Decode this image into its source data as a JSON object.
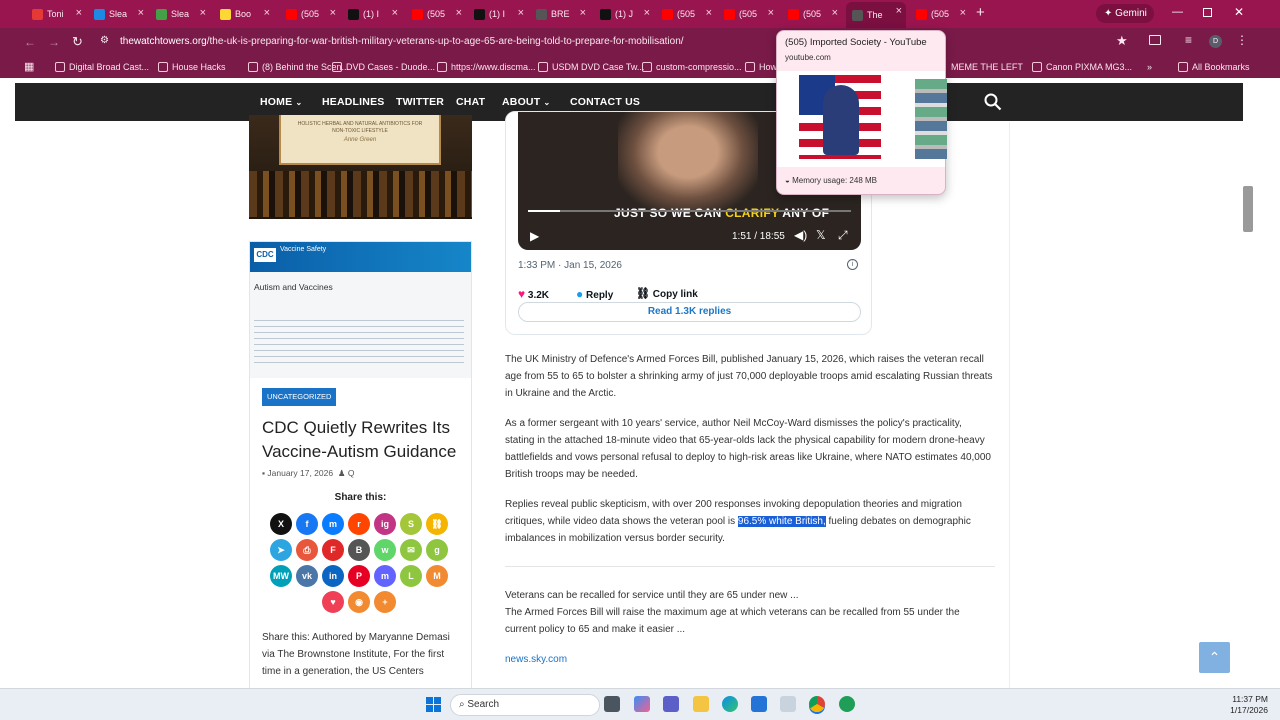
{
  "browser": {
    "tabs": [
      {
        "label": "Toni",
        "color": "#e53935"
      },
      {
        "label": "Slea",
        "color": "#1e88e5"
      },
      {
        "label": "Slea",
        "color": "#43a047"
      },
      {
        "label": "Boo",
        "color": "#fdd835"
      },
      {
        "label": "(505",
        "color": "#ff0000"
      },
      {
        "label": "(1) I",
        "color": "#111111"
      },
      {
        "label": "(505",
        "color": "#ff0000"
      },
      {
        "label": "(1) I",
        "color": "#111111"
      },
      {
        "label": "BRE",
        "color": "#555555"
      },
      {
        "label": "(1) J",
        "color": "#111111"
      },
      {
        "label": "(505",
        "color": "#ff0000"
      },
      {
        "label": "(505",
        "color": "#ff0000"
      },
      {
        "label": "(505",
        "color": "#ff0000"
      },
      {
        "label": "The",
        "color": "#555555"
      },
      {
        "label": "(505",
        "color": "#ff0000"
      }
    ],
    "new_tab_icon": "plus-icon",
    "gemini_label": "Gemini",
    "url_domain": "thewatchtowers.org",
    "url_path": "/the-uk-is-preparing-for-war-british-military-veterans-up-to-age-65-are-being-told-to-prepare-for-mobilisation/",
    "bookmarks": [
      "Digital Broad Cast...",
      "House Hacks",
      "(8) Behind the Scen...",
      "DVD Cases - Duode...",
      "https://www.discma...",
      "USDM DVD Case Tw...",
      "custom-compressio...",
      "How",
      "MEME THE LEFT",
      "Canon PIXMA MG3..."
    ],
    "all_bookmarks": "All Bookmarks",
    "tooltip": {
      "title": "(505) Imported Society - YouTube",
      "domain": "youtube.com",
      "memory": "Memory usage: 248 MB"
    }
  },
  "site_nav": {
    "items": [
      "HOME",
      "HEADLINES",
      "TWITTER",
      "CHAT",
      "ABOUT",
      "CONTACT US"
    ]
  },
  "sidebar_card": {
    "book_text": "HOLISTIC HERBAL AND NATURAL ANTIBIOTICS FOR NON-TOXIC LIFESTYLE",
    "book_author": "Anne Green",
    "thumb_brand": "CDC",
    "thumb_heading": "Vaccine Safety",
    "thumb_title": "Autism and Vaccines",
    "category": "UNCATEGORIZED",
    "title": "CDC Quietly Rewrites Its Vaccine-Autism Guidance",
    "date": "January 17, 2026",
    "author": "Q",
    "share_heading": "Share this:",
    "excerpt": "Share this: Authored by Maryanne Demasi via The Brownstone Institute, For the first time in a generation, the US Centers"
  },
  "tweet": {
    "caption_part1": "JUST SO WE CAN",
    "caption_highlight": "CLARIFY",
    "caption_part2": "ANY OF",
    "video_time": "1:51 / 18:55",
    "timestamp": "1:33 PM · Jan 15, 2026",
    "likes": "3.2K",
    "reply_label": "Reply",
    "copy_link_label": "Copy link",
    "read_replies": "Read 1.3K replies"
  },
  "article": {
    "p1": "The UK Ministry of Defence's Armed Forces Bill, published January 15, 2026, which raises the veteran recall age from 55 to 65 to bolster a shrinking army of just 70,000 deployable troops amid escalating Russian threats in Ukraine and the Arctic.",
    "p2": "As a former sergeant with 10 years' service, author Neil McCoy-Ward dismisses the policy's practicality, stating in the attached 18-minute video that 65-year-olds lack the physical capability for modern drone-heavy battlefields and vows personal refusal to deploy to high-risk areas like Ukraine, where NATO estimates 40,000 British troops may be needed.",
    "p3_before": "Replies reveal public skepticism, with over 200 responses invoking depopulation theories and migration critiques, while video data shows the veteran pool is ",
    "p3_highlight": "96.5% white British,",
    "p3_after": " fueling debates on demographic imbalances in mobilization versus border security.",
    "link_title": "Veterans can be recalled for service until they are 65 under new ...",
    "link_desc": "The Armed Forces Bill will raise the maximum age at which veterans can be recalled from 55 under the current policy to 65 and make it easier ...",
    "link_source": "news.sky.com"
  },
  "taskbar": {
    "search_label": "Search",
    "time": "11:37 PM",
    "date": "1/17/2026"
  }
}
